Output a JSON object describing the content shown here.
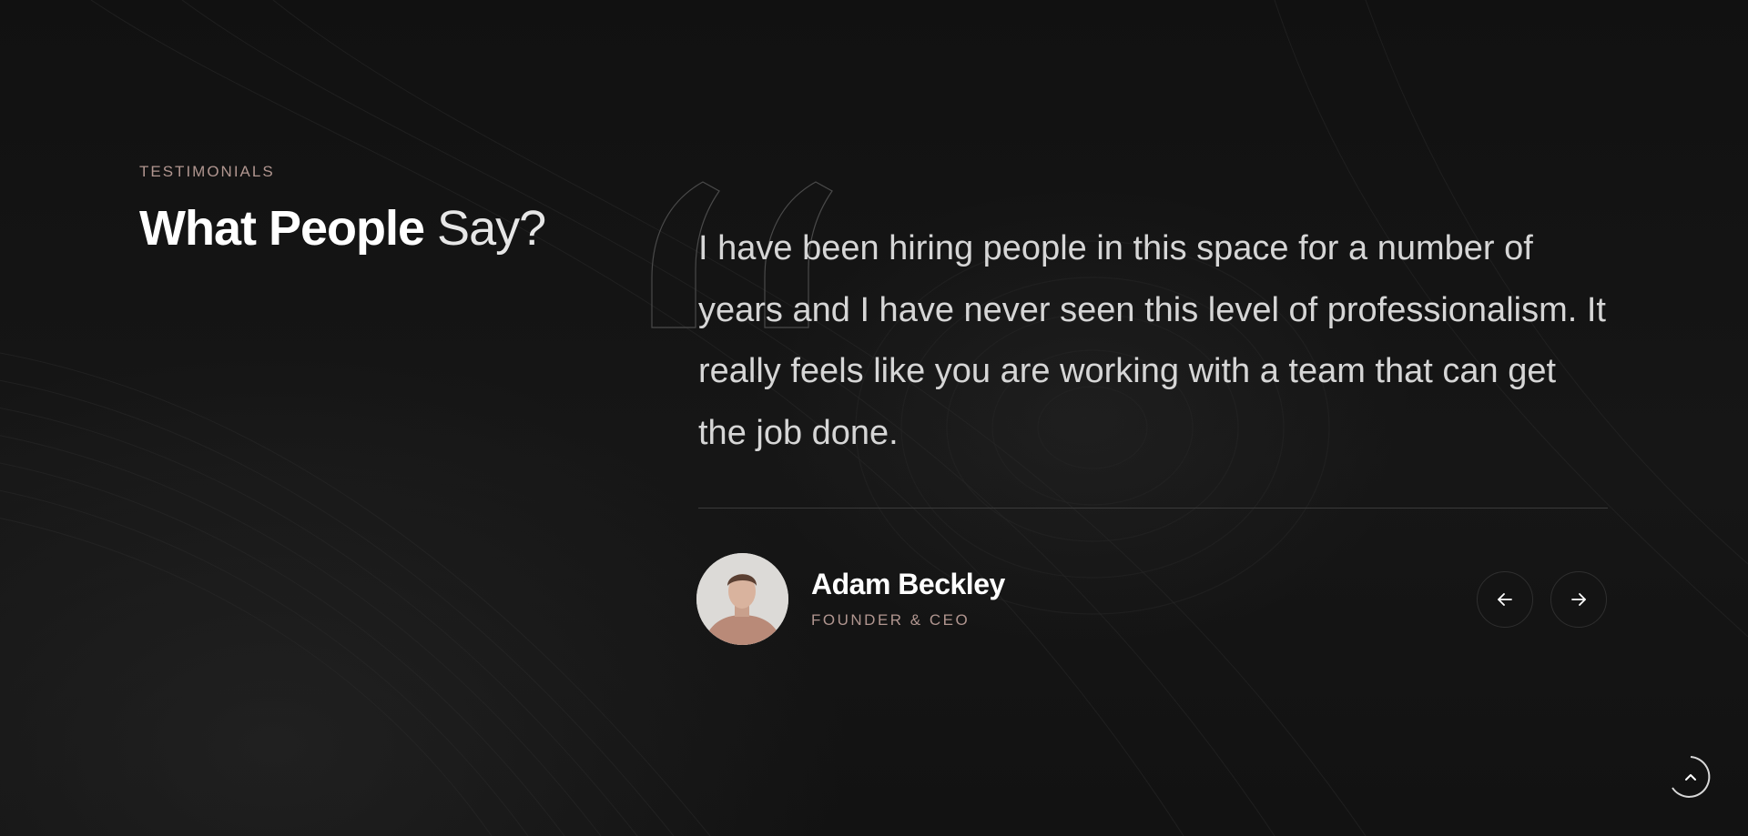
{
  "testimonials": {
    "section_label": "TESTIMONIALS",
    "heading_strong": "What People",
    "heading_light": "Say?",
    "quote_icon": "quote-open-icon",
    "quote": "I have been hiring people in this space for a number of years and I have never seen this level of professionalism. It really feels like you are working with a team that can get the job done.",
    "author": {
      "name": "Adam Beckley",
      "role": "FOUNDER & CEO"
    },
    "controls": {
      "prev_icon": "arrow-left-icon",
      "next_icon": "arrow-right-icon"
    }
  },
  "scroll_top": {
    "icon": "chevron-up-icon"
  },
  "colors": {
    "background": "#141414",
    "accent_label": "#b19690",
    "heading": "#ffffff",
    "quote_text": "#d6d6d6"
  }
}
